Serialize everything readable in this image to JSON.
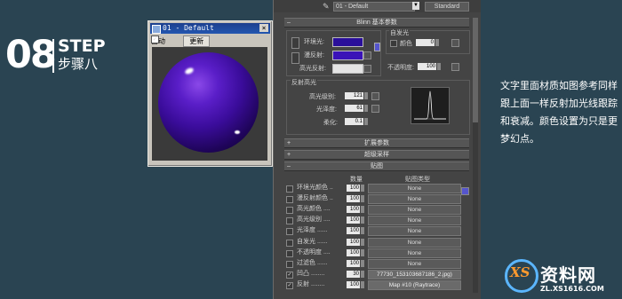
{
  "step": {
    "number": "08",
    "word": "STEP",
    "subtitle": "步骤八"
  },
  "preview_window": {
    "title": "01 - Default",
    "close": "×",
    "auto_label": "自动",
    "auto_checked": true,
    "update_button": "更新"
  },
  "editor": {
    "toolbar": {
      "material_name": "01 - Default",
      "type_button": "Standard"
    },
    "blinn_rollout": "Blinn 基本参数",
    "self_illum": {
      "group_label": "自发光",
      "color_label": "颜色",
      "value": "0"
    },
    "ambient_label": "环境光:",
    "diffuse_label": "漫反射:",
    "specular_label": "高光反射:",
    "opacity_label": "不透明度:",
    "opacity_value": "100",
    "specular_group": "反射高光",
    "specular_level_label": "高光级别:",
    "specular_level_value": "121",
    "glossiness_label": "光泽度:",
    "glossiness_value": "61",
    "soften_label": "柔化:",
    "soften_value": "0.1",
    "rollouts": {
      "extended": "扩展参数",
      "supersampling": "超级采样",
      "maps": "贴图"
    },
    "colors": {
      "ambient": "#2a0f9a",
      "diffuse": "#3a12b8",
      "specular": "#e4e4e4",
      "self_illum_swatch": "#3a3a3a"
    },
    "maps_headers": {
      "amount": "数量",
      "map_type": "贴图类型"
    },
    "maps": [
      {
        "name": "环境光颜色 ..",
        "amount": "100",
        "map": "None",
        "checked": false
      },
      {
        "name": "漫反射颜色 ..",
        "amount": "100",
        "map": "None",
        "checked": false
      },
      {
        "name": "高光颜色 ....",
        "amount": "100",
        "map": "None",
        "checked": false
      },
      {
        "name": "高光级别 ....",
        "amount": "100",
        "map": "None",
        "checked": false
      },
      {
        "name": "光泽度 ......",
        "amount": "100",
        "map": "None",
        "checked": false
      },
      {
        "name": "自发光 ......",
        "amount": "100",
        "map": "None",
        "checked": false
      },
      {
        "name": "不透明度 ....",
        "amount": "100",
        "map": "None",
        "checked": false
      },
      {
        "name": "过滤色 ......",
        "amount": "100",
        "map": "None",
        "checked": false
      },
      {
        "name": "凹凸 ........",
        "amount": "30",
        "map": "77730_153103687186_2.jpg)",
        "checked": true
      },
      {
        "name": "反射 ........",
        "amount": "100",
        "map": "Map #10 (Raytrace)",
        "checked": true
      }
    ]
  },
  "description": "文字里面材质如图参考同样跟上面一样反射加光线跟踪和衰减。颜色设置为只是更梦幻点。",
  "watermark": {
    "mark": "XS",
    "name": "资料网",
    "url": "ZL.XS1616.COM"
  }
}
